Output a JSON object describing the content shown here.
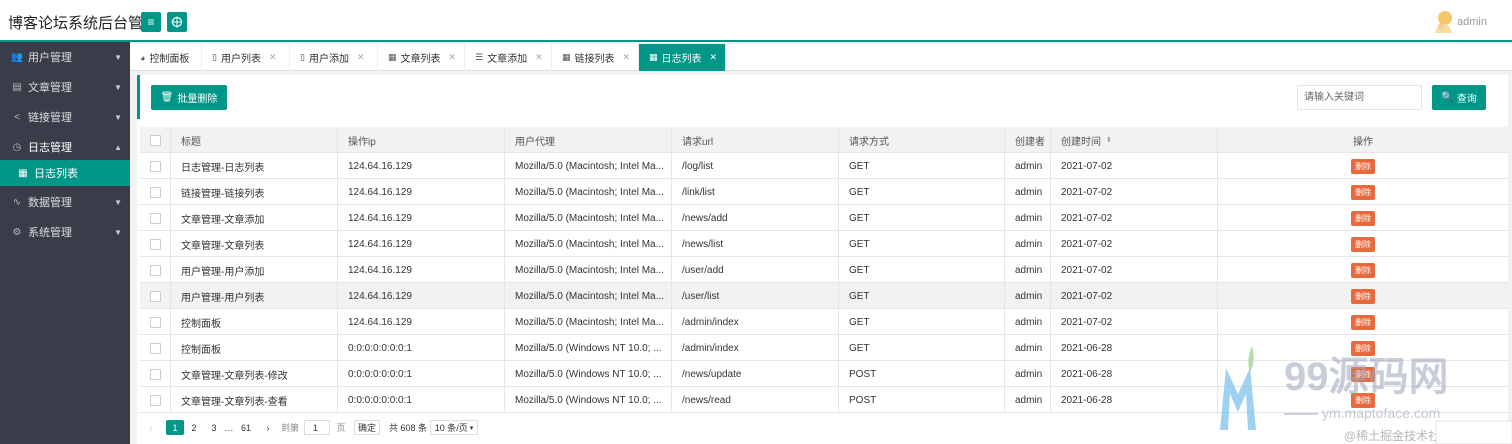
{
  "app": {
    "title": "博客论坛系统后台管理",
    "user": "admin"
  },
  "header": {
    "menu_icon": "hamburger-icon",
    "refresh_icon": "globe-icon"
  },
  "sidebar": {
    "items": [
      {
        "label": "用户管理",
        "icon": "users-icon",
        "expanded": false
      },
      {
        "label": "文章管理",
        "icon": "document-icon",
        "expanded": false
      },
      {
        "label": "链接管理",
        "icon": "share-icon",
        "expanded": false
      },
      {
        "label": "日志管理",
        "icon": "clock-icon",
        "expanded": true
      },
      {
        "label": "日志列表",
        "icon": "table-icon",
        "sub": true,
        "active": true
      },
      {
        "label": "数据管理",
        "icon": "pulse-icon",
        "expanded": false
      },
      {
        "label": "系统管理",
        "icon": "cogs-icon",
        "expanded": false
      }
    ]
  },
  "tabs": [
    {
      "label": "控制面板",
      "icon": "dashboard-icon",
      "closable": false
    },
    {
      "label": "用户列表",
      "icon": "file-icon",
      "closable": true
    },
    {
      "label": "用户添加",
      "icon": "file-icon",
      "closable": true
    },
    {
      "label": "文章列表",
      "icon": "table-icon",
      "closable": true
    },
    {
      "label": "文章添加",
      "icon": "list-icon",
      "closable": true
    },
    {
      "label": "链接列表",
      "icon": "table-icon",
      "closable": true
    },
    {
      "label": "日志列表",
      "icon": "table-icon",
      "closable": true,
      "active": true
    }
  ],
  "toolbar": {
    "batch_delete": "批量删除",
    "search_placeholder": "请输入关键词",
    "search_button": "查询"
  },
  "table": {
    "headers": [
      "标题",
      "操作ip",
      "用户代理",
      "请求url",
      "请求方式",
      "创建者",
      "创建时间",
      "操作"
    ],
    "rows": [
      [
        "日志管理-日志列表",
        "124.64.16.129",
        "Mozilla/5.0 (Macintosh; Intel Ma...",
        "/log/list",
        "GET",
        "admin",
        "2021-07-02"
      ],
      [
        "链接管理-链接列表",
        "124.64.16.129",
        "Mozilla/5.0 (Macintosh; Intel Ma...",
        "/link/list",
        "GET",
        "admin",
        "2021-07-02"
      ],
      [
        "文章管理-文章添加",
        "124.64.16.129",
        "Mozilla/5.0 (Macintosh; Intel Ma...",
        "/news/add",
        "GET",
        "admin",
        "2021-07-02"
      ],
      [
        "文章管理-文章列表",
        "124.64.16.129",
        "Mozilla/5.0 (Macintosh; Intel Ma...",
        "/news/list",
        "GET",
        "admin",
        "2021-07-02"
      ],
      [
        "用户管理-用户添加",
        "124.64.16.129",
        "Mozilla/5.0 (Macintosh; Intel Ma...",
        "/user/add",
        "GET",
        "admin",
        "2021-07-02"
      ],
      [
        "用户管理-用户列表",
        "124.64.16.129",
        "Mozilla/5.0 (Macintosh; Intel Ma...",
        "/user/list",
        "GET",
        "admin",
        "2021-07-02"
      ],
      [
        "控制面板",
        "124.64.16.129",
        "Mozilla/5.0 (Macintosh; Intel Ma...",
        "/admin/index",
        "GET",
        "admin",
        "2021-07-02"
      ],
      [
        "控制面板",
        "0:0:0:0:0:0:0:1",
        "Mozilla/5.0 (Windows NT 10.0; ...",
        "/admin/index",
        "GET",
        "admin",
        "2021-06-28"
      ],
      [
        "文章管理-文章列表-修改",
        "0:0:0:0:0:0:0:1",
        "Mozilla/5.0 (Windows NT 10.0; ...",
        "/news/update",
        "POST",
        "admin",
        "2021-06-28"
      ],
      [
        "文章管理-文章列表-查看",
        "0:0:0:0:0:0:0:1",
        "Mozilla/5.0 (Windows NT 10.0; ...",
        "/news/read",
        "POST",
        "admin",
        "2021-06-28"
      ]
    ],
    "delete_label": "删除"
  },
  "pager": {
    "pages": [
      "1",
      "2",
      "3",
      "…",
      "61"
    ],
    "current": "1",
    "goto_label": "到第",
    "goto_value": "1",
    "page_suffix": "页",
    "confirm": "确定",
    "total": "共 608 条",
    "page_size": "10 条/页"
  },
  "watermark": {
    "text": "99源码网",
    "url": "ym.maptoface.com",
    "community": "@稀土掘金技术社区"
  },
  "colors": {
    "primary": "#009688",
    "sidebar": "#393d49",
    "danger": "#e8693c"
  }
}
